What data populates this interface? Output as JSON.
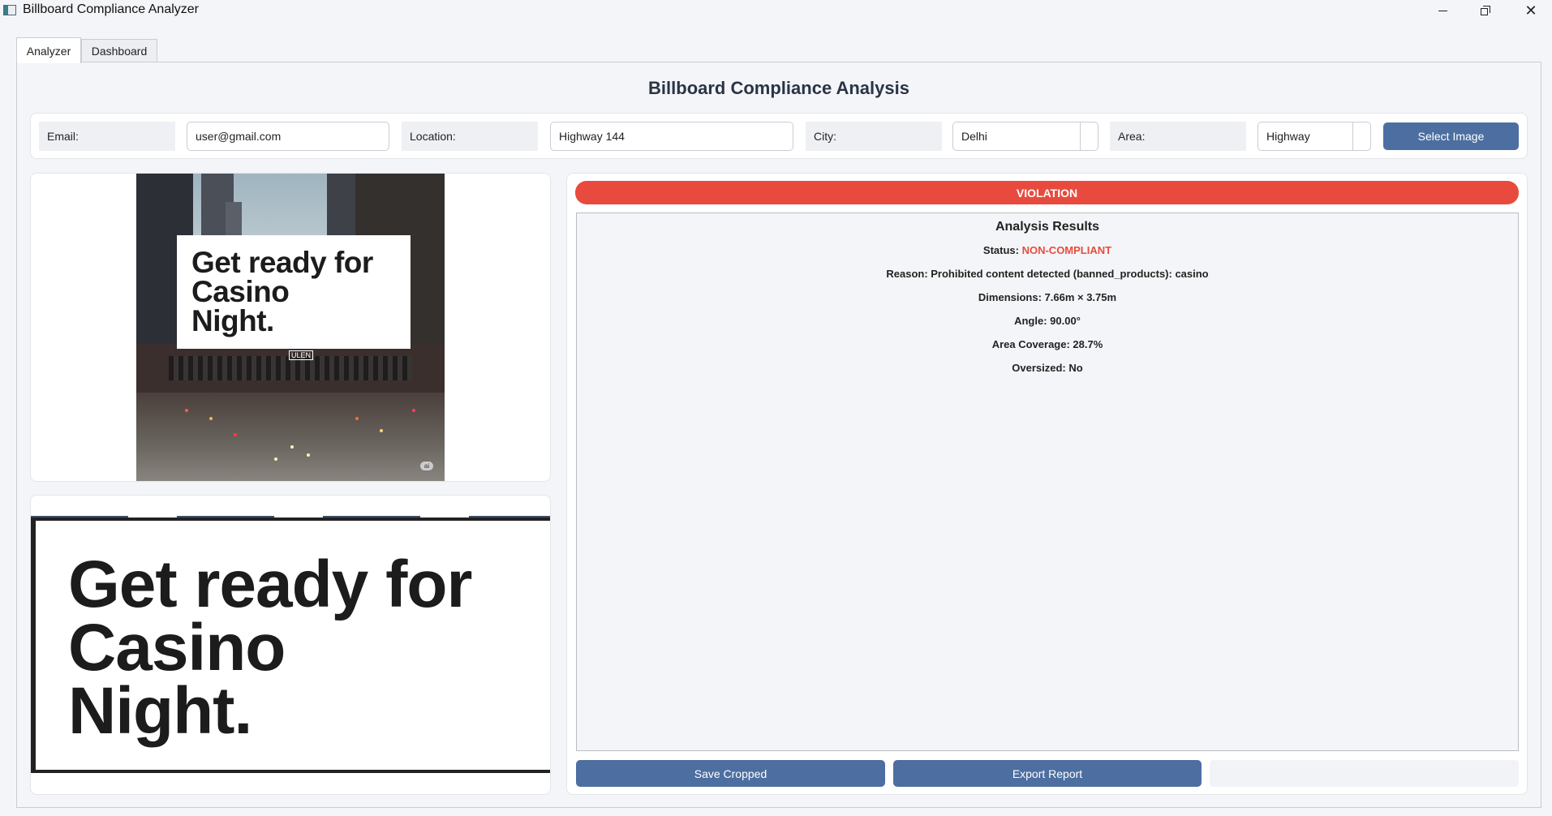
{
  "window": {
    "title": "Billboard Compliance Analyzer"
  },
  "tabs": [
    {
      "label": "Analyzer",
      "active": true
    },
    {
      "label": "Dashboard",
      "active": false
    }
  ],
  "page_title": "Billboard Compliance Analysis",
  "form": {
    "email_label": "Email:",
    "email_value": "user@gmail.com",
    "location_label": "Location:",
    "location_value": "Highway 144",
    "city_label": "City:",
    "city_value": "Delhi",
    "area_label": "Area:",
    "area_value": "Highway",
    "select_image_label": "Select Image"
  },
  "billboard": {
    "line1": "Get ready for",
    "line2": "Casino",
    "line3": "Night.",
    "brand": "ULEN",
    "badge": "ai"
  },
  "status_banner": "VIOLATION",
  "results": {
    "title": "Analysis Results",
    "status_label": "Status:",
    "status_value": "NON-COMPLIANT",
    "reason": "Reason: Prohibited content detected (banned_products): casino",
    "dimensions": "Dimensions: 7.66m × 3.75m",
    "angle": "Angle: 90.00°",
    "area_coverage": "Area Coverage: 28.7%",
    "oversized": "Oversized: No"
  },
  "actions": {
    "save_cropped": "Save Cropped",
    "export_report": "Export Report"
  },
  "colors": {
    "accent": "#4d6ea0",
    "violation": "#e84b3d",
    "title": "#2a3446"
  }
}
